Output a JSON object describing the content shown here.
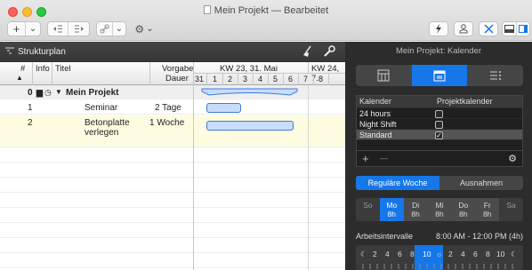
{
  "window": {
    "title": "Mein Projekt — Bearbeitet"
  },
  "toolbar": {
    "add_label": "+",
    "add_menu": "⌄",
    "settings_menu": "⌄"
  },
  "left_pane": {
    "title": "Strukturplan",
    "columns": {
      "num": "#",
      "info": "Info",
      "title": "Titel",
      "vorgabe": "Vorgabe",
      "dauer": "Dauer"
    },
    "gantt": {
      "week1": "KW 23, 31. Mai",
      "week2": "KW 24, 7.",
      "days": [
        "31",
        "1",
        "2",
        "3",
        "4",
        "5",
        "6",
        "7",
        "8"
      ]
    },
    "rows": [
      {
        "num": "0",
        "title": "Mein Projekt",
        "duration": "",
        "summary": true
      },
      {
        "num": "1",
        "title": "Seminar",
        "duration": "2 Tage",
        "summary": false
      },
      {
        "num": "2",
        "title": "Betonplatte",
        "title2": "verlegen",
        "duration": "1 Woche",
        "summary": false
      }
    ]
  },
  "right_panel": {
    "title": "Mein Projekt: Kalender",
    "table": {
      "col1": "Kalender",
      "col2": "Projektkalender",
      "rows": [
        {
          "name": "24 hours",
          "checked": ""
        },
        {
          "name": "Night Shift",
          "checked": ""
        },
        {
          "name": "Standard",
          "checked": "✓"
        }
      ],
      "add": "+",
      "remove": "—",
      "gear": "⚙"
    },
    "week_tabs": {
      "regular": "Reguläre Woche",
      "exceptions": "Ausnahmen"
    },
    "days": [
      {
        "name": "So",
        "hours": ""
      },
      {
        "name": "Mo",
        "hours": "8h"
      },
      {
        "name": "Di",
        "hours": "8h"
      },
      {
        "name": "Mi",
        "hours": "8h"
      },
      {
        "name": "Do",
        "hours": "8h"
      },
      {
        "name": "Fr",
        "hours": "8h"
      },
      {
        "name": "Sa",
        "hours": ""
      }
    ],
    "arbeitsintervalle_label": "Arbeitsintervalle",
    "arbeitsintervalle_value": "8:00 AM - 12:00 PM (4h)",
    "timeline_labels": [
      "☾",
      "2",
      "4",
      "6",
      "8",
      "10",
      "☼",
      "2",
      "4",
      "6",
      "8",
      "10",
      "☾"
    ]
  },
  "colors": {
    "accent": "#1677e8",
    "bar_fill": "#c8dcfb",
    "bar_border": "#3c7bd8",
    "selected_row": "#fdfce0"
  }
}
